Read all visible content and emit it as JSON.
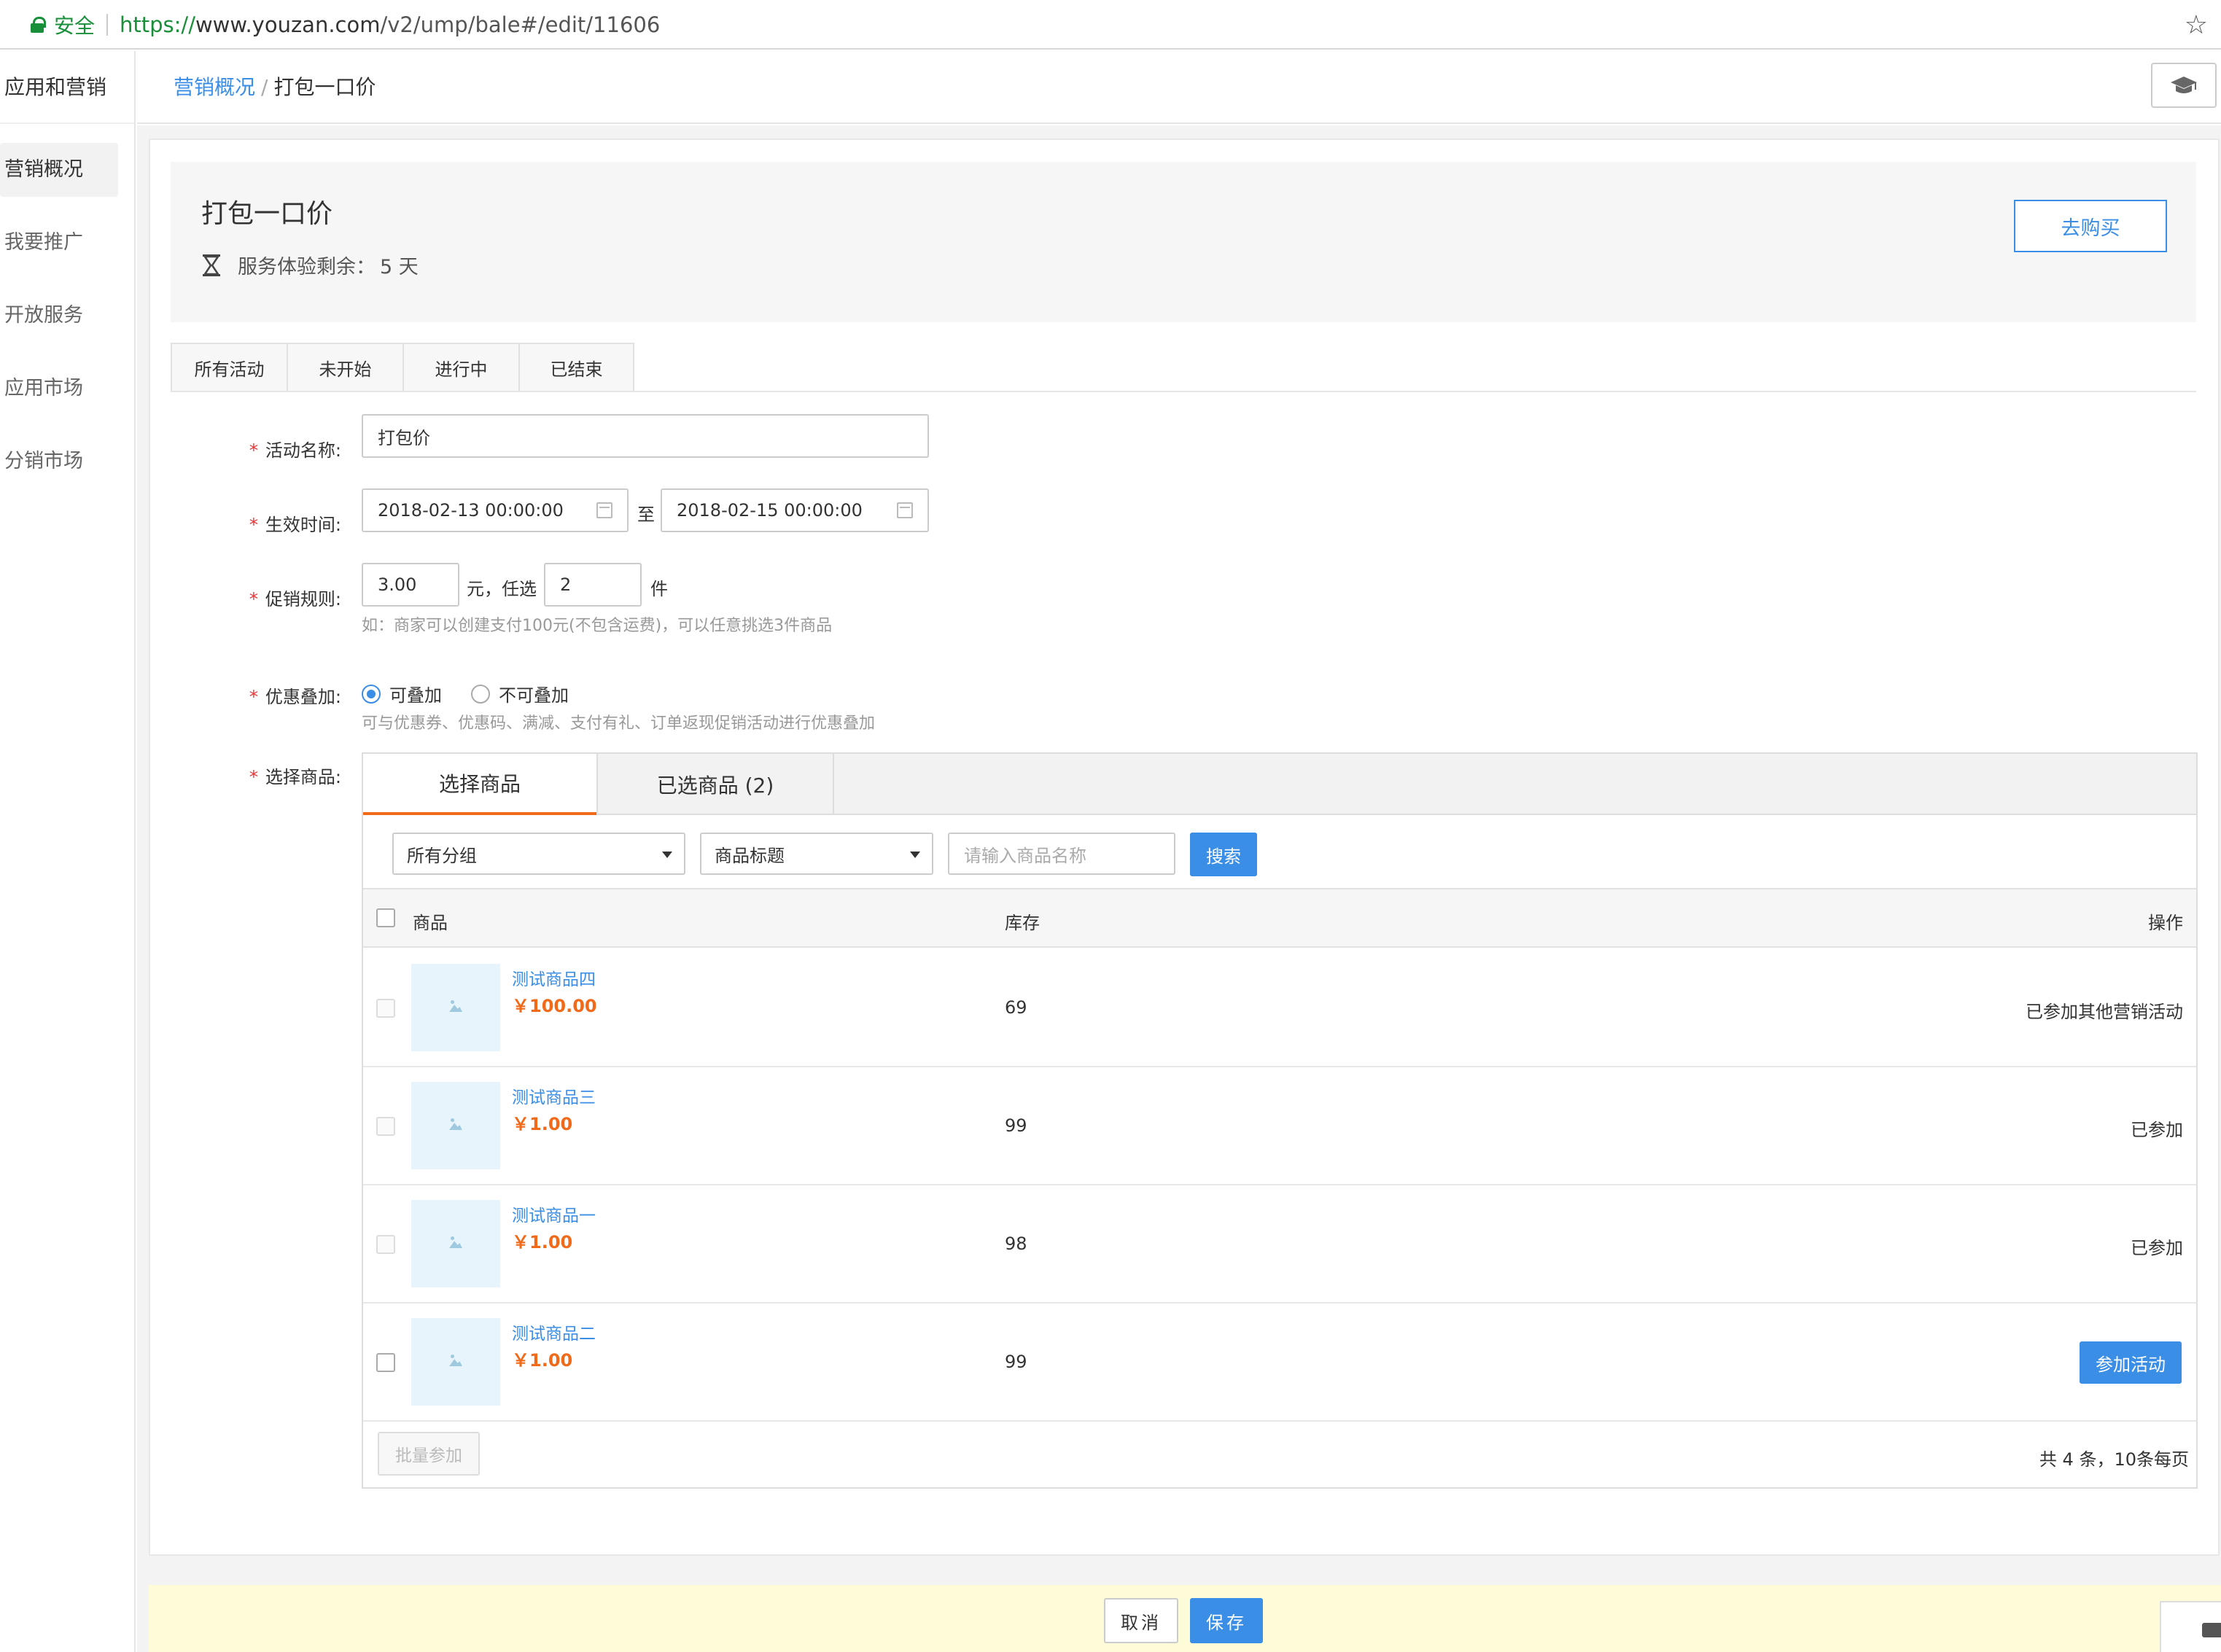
{
  "browser": {
    "secure_label": "安全",
    "url_scheme": "https://",
    "url_host": "www.youzan.com",
    "url_path": "/v2/ump/bale#/edit/11606"
  },
  "sidebar": {
    "title": "应用和营销",
    "items": [
      {
        "label": "营销概况",
        "active": true
      },
      {
        "label": "我要推广",
        "active": false
      },
      {
        "label": "开放服务",
        "active": false
      },
      {
        "label": "应用市场",
        "active": false
      },
      {
        "label": "分销市场",
        "active": false
      }
    ]
  },
  "header": {
    "breadcrumb_link": "营销概况",
    "breadcrumb_sep": "/",
    "breadcrumb_current": "打包一口价",
    "help_icon": "graduation-cap-icon"
  },
  "info": {
    "name": "打包一口价",
    "trial_label": "服务体验剩余：",
    "trial_value": "5 天",
    "buy_button": "去购买"
  },
  "status_tabs": [
    "所有活动",
    "未开始",
    "进行中",
    "已结束"
  ],
  "form": {
    "name": {
      "label": "活动名称:",
      "value": "打包价"
    },
    "time": {
      "label": "生效时间:",
      "start": "2018-02-13 00:00:00",
      "to": "至",
      "end": "2018-02-15 00:00:00"
    },
    "rule": {
      "label": "促销规则:",
      "amount": "3.00",
      "mid_text": "元，任选",
      "count": "2",
      "unit": "件",
      "hint": "如：商家可以创建支付100元(不包含运费)，可以任意挑选3件商品"
    },
    "stack": {
      "label": "优惠叠加:",
      "option_yes": "可叠加",
      "option_no": "不可叠加",
      "selected": "可叠加",
      "hint": "可与优惠券、优惠码、满减、支付有礼、订单返现促销活动进行优惠叠加"
    },
    "goods_label": "选择商品:"
  },
  "picker": {
    "tab_select": "选择商品",
    "tab_selected": "已选商品 (2)",
    "group_select": "所有分组",
    "field_select": "商品标题",
    "search_placeholder": "请输入商品名称",
    "search_button": "搜索",
    "columns": {
      "product": "商品",
      "stock": "库存",
      "action": "操作"
    },
    "rows": [
      {
        "name": "测试商品四",
        "price": "￥100.00",
        "stock": "69",
        "action": "已参加其他营销活动",
        "is_button": false
      },
      {
        "name": "测试商品三",
        "price": "￥1.00",
        "stock": "99",
        "action": "已参加",
        "is_button": false
      },
      {
        "name": "测试商品一",
        "price": "￥1.00",
        "stock": "98",
        "action": "已参加",
        "is_button": false
      },
      {
        "name": "测试商品二",
        "price": "￥1.00",
        "stock": "99",
        "action": "参加活动",
        "is_button": true
      }
    ],
    "batch_button": "批量参加",
    "pagination": "共 4 条，10条每页"
  },
  "footer": {
    "cancel": "取消",
    "save": "保存"
  },
  "colors": {
    "primary": "#3a8ee6",
    "price": "#f06a1a",
    "required": "#ee3333",
    "footer_bg": "#fdfbd8",
    "secure": "#1a8f3a"
  }
}
